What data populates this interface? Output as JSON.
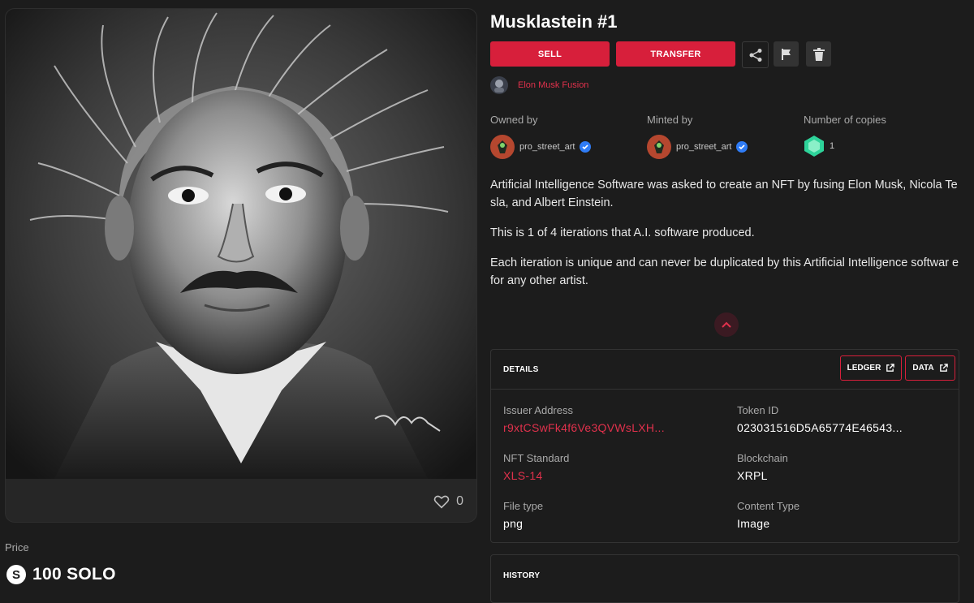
{
  "nft": {
    "title": "Musklastein #1",
    "likes": "0",
    "price_label": "Price",
    "price_value": "100 SOLO"
  },
  "actions": {
    "sell_label": "SELL",
    "transfer_label": "TRANSFER",
    "icons": [
      "share-icon",
      "flag-icon",
      "trash-icon"
    ]
  },
  "collection": {
    "name": "Elon Musk Fusion"
  },
  "meta": {
    "owned_by_label": "Owned by",
    "owner": "pro_street_art",
    "minted_by_label": "Minted by",
    "minter": "pro_street_art",
    "copies_label": "Number of copies",
    "copies": "1"
  },
  "description": [
    "Artificial Intelligence Software was asked to create an NFT by fusing Elon Musk, Nicola Te sla, and Albert Einstein.",
    "This is 1 of 4 iterations that A.I. software produced.",
    "Each iteration is unique and can never be duplicated by this Artificial Intelligence softwar e for any other artist."
  ],
  "details": {
    "title": "DETAILS",
    "ledger_label": "LEDGER",
    "data_label": "DATA",
    "issuer_address_label": "Issuer Address",
    "issuer_address": "r9xtCSwFk4f6Ve3QVWsLXH...",
    "token_id_label": "Token ID",
    "token_id": "023031516D5A65774E46543...",
    "nft_standard_label": "NFT Standard",
    "nft_standard": "XLS-14",
    "blockchain_label": "Blockchain",
    "blockchain": "XRPL",
    "file_type_label": "File type",
    "file_type": "png",
    "content_type_label": "Content Type",
    "content_type": "Image"
  },
  "history": {
    "title": "HISTORY"
  },
  "colors": {
    "accent": "#d71f3b",
    "accent_text": "#e0314c",
    "background": "#1c1c1c",
    "verified": "#2f7cf6",
    "copies_gem": "#2ed39a"
  }
}
